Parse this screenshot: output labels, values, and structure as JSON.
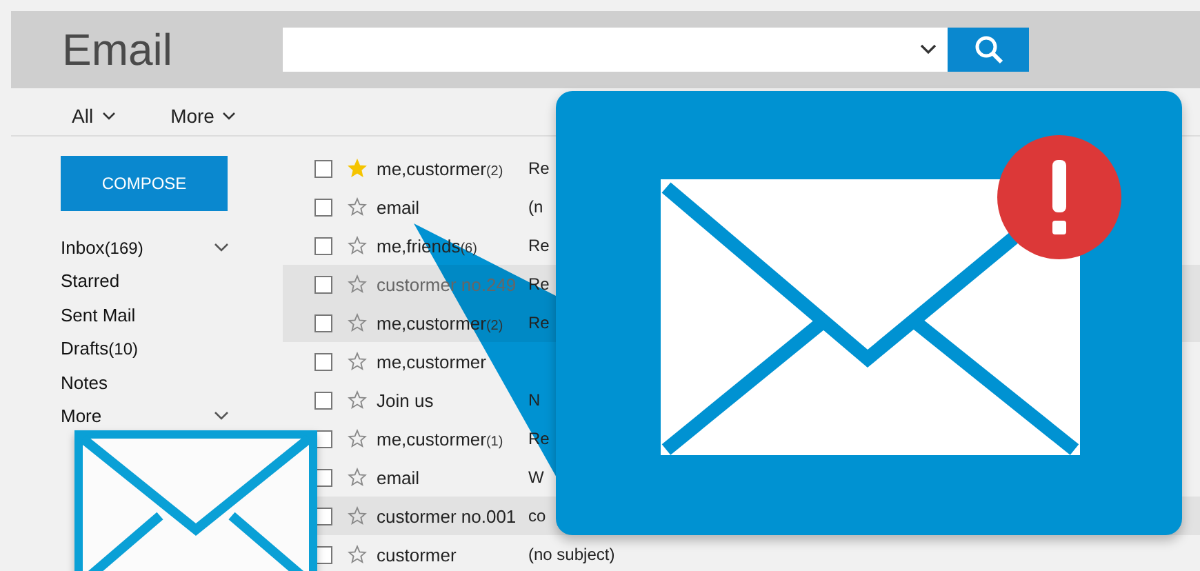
{
  "header": {
    "title": "Email"
  },
  "toolbar": [
    {
      "label": "All"
    },
    {
      "label": "More"
    }
  ],
  "sidebar": {
    "compose": "COMPOSE",
    "items": [
      {
        "label": "Inbox",
        "count": "(169)",
        "expandable": true
      },
      {
        "label": "Starred",
        "expandable": false
      },
      {
        "label": "Sent Mail",
        "expandable": false
      },
      {
        "label": "Drafts",
        "count": "(10)",
        "expandable": false
      },
      {
        "label": "Notes",
        "expandable": false
      },
      {
        "label": "More",
        "expandable": true
      }
    ]
  },
  "messages": [
    {
      "checked": false,
      "starred": true,
      "sender": "me,custormer",
      "count": "(2)",
      "subject": "Re",
      "highlighted": false,
      "dimmed": false
    },
    {
      "checked": false,
      "starred": false,
      "sender": "email",
      "subject": "(n",
      "highlighted": false,
      "dimmed": false
    },
    {
      "checked": false,
      "starred": false,
      "sender": "me,friends",
      "count": "(6)",
      "subject": "Re",
      "highlighted": false,
      "dimmed": false
    },
    {
      "checked": false,
      "starred": false,
      "sender": "custormer no.249",
      "subject": "Re",
      "highlighted": true,
      "dimmed": true
    },
    {
      "checked": false,
      "starred": false,
      "sender": "me,custormer",
      "count": "(2)",
      "subject": "Re",
      "highlighted": true,
      "dimmed": false
    },
    {
      "checked": false,
      "starred": false,
      "sender": "me,custormer",
      "highlighted": false,
      "dimmed": false
    },
    {
      "checked": false,
      "starred": false,
      "sender": "Join us",
      "subject": "N",
      "highlighted": false,
      "dimmed": false
    },
    {
      "checked": false,
      "starred": false,
      "sender": "me,custormer",
      "count": "(1)",
      "subject": "Re",
      "highlighted": false,
      "dimmed": false
    },
    {
      "checked": false,
      "starred": false,
      "sender": "email",
      "subject": "W",
      "highlighted": false,
      "dimmed": false
    },
    {
      "checked": false,
      "starred": false,
      "sender": "custormer no.001",
      "subject": "co",
      "highlighted": true,
      "dimmed": false
    },
    {
      "checked": false,
      "starred": false,
      "sender": "custormer",
      "subject": "(no subject)",
      "highlighted": false,
      "dimmed": false
    }
  ],
  "alert": {
    "shown": true
  }
}
